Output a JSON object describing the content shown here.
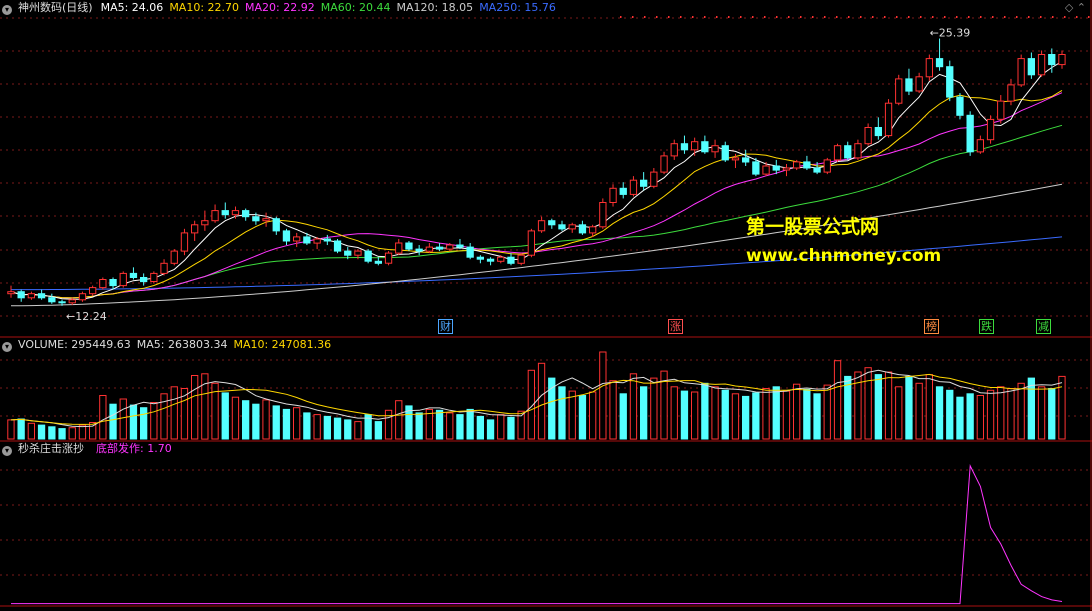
{
  "header": {
    "main": {
      "stock": "神州数码(日线)",
      "ma": [
        {
          "label": "MA5: 24.06",
          "color": "#ffffff"
        },
        {
          "label": "MA10: 22.70",
          "color": "#ffd700"
        },
        {
          "label": "MA20: 22.92",
          "color": "#ff35ff"
        },
        {
          "label": "MA60: 20.44",
          "color": "#3ddc3d"
        },
        {
          "label": "MA120: 18.05",
          "color": "#cccccc"
        },
        {
          "label": "MA250: 15.76",
          "color": "#3a6bff"
        }
      ]
    },
    "volume": {
      "items": [
        {
          "label": "VOLUME: 295449.63",
          "color": "#dddddd"
        },
        {
          "label": "MA5: 263803.34",
          "color": "#dddddd"
        },
        {
          "label": "MA10: 247081.36",
          "color": "#ffd700"
        }
      ]
    },
    "indicator": {
      "name": "秒杀庄击涨抄",
      "item": {
        "label": "底部发作: 1.70",
        "color": "#ff35ff"
      }
    }
  },
  "watermark": {
    "cn": "第一股票公式网",
    "url": "www.chnmoney.com",
    "color": "#ffff00"
  },
  "events": [
    {
      "label": "财",
      "color": "#4da6ff"
    },
    {
      "label": "涨",
      "color": "#ff5050"
    },
    {
      "label": "榜",
      "color": "#ff8c40"
    },
    {
      "label": "跌",
      "color": "#3ddc3d"
    },
    {
      "label": "减",
      "color": "#3ddc3d"
    }
  ],
  "colors": {
    "up": "#ff3232",
    "down": "#54ffff",
    "grid": "#7a1a1a",
    "separator": "#aa1010",
    "indicator_line": "#ff35ff"
  },
  "chart_data": {
    "type": "candlestick",
    "price_range": [
      11.6,
      26.6
    ],
    "annotations": {
      "high": "25.39",
      "low": "12.24"
    },
    "candles": [
      [
        12.8,
        13.2,
        12.6,
        12.9
      ],
      [
        12.9,
        13.0,
        12.4,
        12.6
      ],
      [
        12.6,
        12.9,
        12.5,
        12.8
      ],
      [
        12.8,
        13.0,
        12.5,
        12.6
      ],
      [
        12.6,
        12.8,
        12.3,
        12.4
      ],
      [
        12.4,
        12.5,
        12.2,
        12.35
      ],
      [
        12.35,
        12.6,
        12.24,
        12.5
      ],
      [
        12.5,
        12.9,
        12.4,
        12.8
      ],
      [
        12.8,
        13.2,
        12.7,
        13.1
      ],
      [
        13.1,
        13.6,
        13.0,
        13.5
      ],
      [
        13.5,
        13.6,
        13.0,
        13.2
      ],
      [
        13.2,
        13.9,
        13.1,
        13.8
      ],
      [
        13.8,
        14.1,
        13.5,
        13.6
      ],
      [
        13.6,
        13.8,
        13.2,
        13.4
      ],
      [
        13.4,
        13.9,
        13.3,
        13.8
      ],
      [
        13.8,
        14.5,
        13.7,
        14.3
      ],
      [
        14.3,
        15.0,
        14.2,
        14.9
      ],
      [
        14.9,
        16.0,
        14.7,
        15.8
      ],
      [
        15.8,
        16.4,
        15.4,
        16.2
      ],
      [
        16.2,
        16.9,
        15.9,
        16.4
      ],
      [
        16.4,
        17.2,
        16.3,
        16.9
      ],
      [
        16.9,
        17.3,
        16.5,
        16.7
      ],
      [
        16.7,
        17.1,
        16.5,
        16.9
      ],
      [
        16.9,
        17.0,
        16.4,
        16.6
      ],
      [
        16.6,
        16.8,
        16.2,
        16.4
      ],
      [
        16.4,
        16.8,
        16.1,
        16.5
      ],
      [
        16.5,
        16.6,
        15.7,
        15.9
      ],
      [
        15.9,
        16.0,
        15.2,
        15.4
      ],
      [
        15.4,
        15.8,
        15.1,
        15.6
      ],
      [
        15.6,
        15.8,
        15.2,
        15.3
      ],
      [
        15.3,
        15.6,
        15.0,
        15.5
      ],
      [
        15.5,
        15.7,
        15.2,
        15.4
      ],
      [
        15.4,
        15.5,
        14.8,
        14.9
      ],
      [
        14.9,
        15.1,
        14.5,
        14.7
      ],
      [
        14.7,
        15.0,
        14.5,
        14.9
      ],
      [
        14.9,
        15.0,
        14.3,
        14.4
      ],
      [
        14.4,
        14.6,
        14.2,
        14.3
      ],
      [
        14.3,
        14.9,
        14.2,
        14.8
      ],
      [
        14.8,
        15.5,
        14.7,
        15.3
      ],
      [
        15.3,
        15.4,
        14.9,
        15.0
      ],
      [
        15.0,
        15.2,
        14.7,
        14.9
      ],
      [
        14.9,
        15.3,
        14.8,
        15.1
      ],
      [
        15.1,
        15.3,
        14.9,
        15.0
      ],
      [
        15.0,
        15.3,
        14.9,
        15.2
      ],
      [
        15.2,
        15.5,
        15.0,
        15.1
      ],
      [
        15.1,
        15.3,
        14.5,
        14.6
      ],
      [
        14.6,
        14.7,
        14.3,
        14.5
      ],
      [
        14.5,
        14.6,
        14.2,
        14.4
      ],
      [
        14.4,
        14.7,
        14.3,
        14.6
      ],
      [
        14.6,
        14.8,
        14.2,
        14.3
      ],
      [
        14.3,
        14.8,
        14.2,
        14.7
      ],
      [
        14.7,
        16.0,
        14.6,
        15.9
      ],
      [
        15.9,
        16.6,
        15.8,
        16.4
      ],
      [
        16.4,
        16.5,
        16.0,
        16.2
      ],
      [
        16.2,
        16.4,
        15.9,
        16.0
      ],
      [
        16.0,
        16.3,
        15.8,
        16.2
      ],
      [
        16.2,
        16.4,
        15.7,
        15.8
      ],
      [
        15.8,
        16.2,
        15.6,
        16.1
      ],
      [
        16.1,
        17.5,
        16.0,
        17.3
      ],
      [
        17.3,
        18.2,
        17.1,
        18.0
      ],
      [
        18.0,
        18.3,
        17.5,
        17.7
      ],
      [
        17.7,
        18.6,
        17.6,
        18.4
      ],
      [
        18.4,
        18.8,
        17.9,
        18.1
      ],
      [
        18.1,
        19.0,
        18.0,
        18.8
      ],
      [
        18.8,
        19.8,
        18.7,
        19.6
      ],
      [
        19.6,
        20.4,
        19.4,
        20.2
      ],
      [
        20.2,
        20.6,
        19.7,
        19.9
      ],
      [
        19.9,
        20.5,
        19.6,
        20.3
      ],
      [
        20.3,
        20.6,
        19.7,
        19.8
      ],
      [
        19.8,
        20.4,
        19.5,
        20.1
      ],
      [
        20.1,
        20.3,
        19.3,
        19.4
      ],
      [
        19.4,
        19.7,
        19.0,
        19.5
      ],
      [
        19.5,
        19.9,
        19.1,
        19.3
      ],
      [
        19.3,
        19.5,
        18.6,
        18.7
      ],
      [
        18.7,
        19.3,
        18.6,
        19.1
      ],
      [
        19.1,
        19.4,
        18.7,
        18.9
      ],
      [
        18.9,
        19.2,
        18.6,
        19.0
      ],
      [
        19.0,
        19.4,
        18.9,
        19.3
      ],
      [
        19.3,
        19.6,
        18.9,
        19.0
      ],
      [
        19.0,
        19.3,
        18.7,
        18.8
      ],
      [
        18.8,
        19.5,
        18.7,
        19.4
      ],
      [
        19.4,
        20.2,
        19.3,
        20.1
      ],
      [
        20.1,
        20.3,
        19.4,
        19.5
      ],
      [
        19.5,
        20.4,
        19.4,
        20.2
      ],
      [
        20.2,
        21.2,
        20.1,
        21.0
      ],
      [
        21.0,
        21.5,
        20.4,
        20.6
      ],
      [
        20.6,
        22.4,
        20.5,
        22.2
      ],
      [
        22.2,
        23.6,
        22.1,
        23.4
      ],
      [
        23.4,
        23.9,
        22.6,
        22.8
      ],
      [
        22.8,
        23.7,
        22.7,
        23.5
      ],
      [
        23.5,
        24.6,
        23.3,
        24.4
      ],
      [
        24.4,
        25.39,
        23.8,
        24.0
      ],
      [
        24.0,
        24.3,
        22.3,
        22.5
      ],
      [
        22.5,
        22.7,
        21.4,
        21.6
      ],
      [
        21.6,
        21.8,
        19.6,
        19.8
      ],
      [
        19.8,
        20.6,
        19.7,
        20.4
      ],
      [
        20.4,
        21.6,
        20.2,
        21.4
      ],
      [
        21.4,
        22.6,
        21.2,
        22.3
      ],
      [
        22.3,
        23.4,
        22.1,
        23.1
      ],
      [
        23.1,
        24.6,
        23.0,
        24.4
      ],
      [
        24.4,
        24.7,
        23.4,
        23.6
      ],
      [
        23.6,
        24.8,
        23.5,
        24.6
      ],
      [
        24.6,
        24.9,
        23.7,
        24.1
      ],
      [
        24.1,
        24.8,
        23.9,
        24.6
      ]
    ],
    "volumes": [
      22,
      23,
      18,
      16,
      14,
      12,
      13,
      16,
      19,
      50,
      40,
      46,
      39,
      36,
      42,
      52,
      60,
      58,
      73,
      75,
      64,
      53,
      48,
      44,
      40,
      45,
      38,
      34,
      36,
      30,
      28,
      26,
      24,
      22,
      20,
      28,
      20,
      33,
      44,
      38,
      30,
      34,
      33,
      30,
      28,
      34,
      26,
      22,
      28,
      25,
      32,
      79,
      87,
      70,
      60,
      55,
      50,
      54,
      100,
      67,
      52,
      75,
      60,
      70,
      78,
      60,
      55,
      54,
      64,
      60,
      56,
      52,
      49,
      53,
      58,
      60,
      55,
      63,
      57,
      52,
      62,
      90,
      72,
      77,
      82,
      74,
      77,
      60,
      72,
      64,
      74,
      60,
      56,
      48,
      52,
      50,
      56,
      60,
      58,
      64,
      70,
      60,
      58,
      72
    ],
    "indicator": {
      "name": "底部发作",
      "range": [
        0,
        18
      ],
      "spike": [
        [
          94,
          16.8
        ],
        [
          95,
          14.3
        ],
        [
          96,
          9.3
        ],
        [
          97,
          7.3
        ],
        [
          98,
          4.7
        ],
        [
          99,
          2.4
        ],
        [
          100,
          1.6
        ],
        [
          101,
          0.9
        ],
        [
          102,
          0.5
        ],
        [
          103,
          0.3
        ]
      ]
    }
  }
}
